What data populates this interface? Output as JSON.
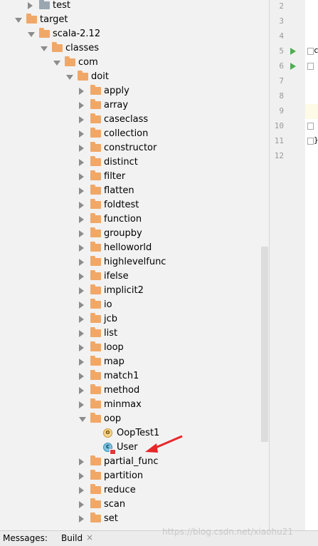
{
  "tree": {
    "rows": [
      {
        "label": "test",
        "depth": 1,
        "expanded": false,
        "type": "folder",
        "grey": true
      },
      {
        "label": "target",
        "depth": 0,
        "expanded": true,
        "type": "folder"
      },
      {
        "label": "scala-2.12",
        "depth": 1,
        "expanded": true,
        "type": "folder"
      },
      {
        "label": "classes",
        "depth": 2,
        "expanded": true,
        "type": "folder"
      },
      {
        "label": "com",
        "depth": 3,
        "expanded": true,
        "type": "folder"
      },
      {
        "label": "doit",
        "depth": 4,
        "expanded": true,
        "type": "folder"
      },
      {
        "label": "apply",
        "depth": 5,
        "expanded": false,
        "type": "folder"
      },
      {
        "label": "array",
        "depth": 5,
        "expanded": false,
        "type": "folder"
      },
      {
        "label": "caseclass",
        "depth": 5,
        "expanded": false,
        "type": "folder"
      },
      {
        "label": "collection",
        "depth": 5,
        "expanded": false,
        "type": "folder"
      },
      {
        "label": "constructor",
        "depth": 5,
        "expanded": false,
        "type": "folder"
      },
      {
        "label": "distinct",
        "depth": 5,
        "expanded": false,
        "type": "folder"
      },
      {
        "label": "filter",
        "depth": 5,
        "expanded": false,
        "type": "folder"
      },
      {
        "label": "flatten",
        "depth": 5,
        "expanded": false,
        "type": "folder"
      },
      {
        "label": "foldtest",
        "depth": 5,
        "expanded": false,
        "type": "folder"
      },
      {
        "label": "function",
        "depth": 5,
        "expanded": false,
        "type": "folder"
      },
      {
        "label": "groupby",
        "depth": 5,
        "expanded": false,
        "type": "folder"
      },
      {
        "label": "helloworld",
        "depth": 5,
        "expanded": false,
        "type": "folder"
      },
      {
        "label": "highlevelfunc",
        "depth": 5,
        "expanded": false,
        "type": "folder"
      },
      {
        "label": "ifelse",
        "depth": 5,
        "expanded": false,
        "type": "folder"
      },
      {
        "label": "implicit2",
        "depth": 5,
        "expanded": false,
        "type": "folder"
      },
      {
        "label": "io",
        "depth": 5,
        "expanded": false,
        "type": "folder"
      },
      {
        "label": "jcb",
        "depth": 5,
        "expanded": false,
        "type": "folder"
      },
      {
        "label": "list",
        "depth": 5,
        "expanded": false,
        "type": "folder"
      },
      {
        "label": "loop",
        "depth": 5,
        "expanded": false,
        "type": "folder"
      },
      {
        "label": "map",
        "depth": 5,
        "expanded": false,
        "type": "folder"
      },
      {
        "label": "match1",
        "depth": 5,
        "expanded": false,
        "type": "folder"
      },
      {
        "label": "method",
        "depth": 5,
        "expanded": false,
        "type": "folder"
      },
      {
        "label": "minmax",
        "depth": 5,
        "expanded": false,
        "type": "folder"
      },
      {
        "label": "oop",
        "depth": 5,
        "expanded": true,
        "type": "folder"
      },
      {
        "label": "OopTest1",
        "depth": 6,
        "type": "object"
      },
      {
        "label": "User",
        "depth": 6,
        "type": "class"
      },
      {
        "label": "partial_func",
        "depth": 5,
        "expanded": false,
        "type": "folder"
      },
      {
        "label": "partition",
        "depth": 5,
        "expanded": false,
        "type": "folder"
      },
      {
        "label": "reduce",
        "depth": 5,
        "expanded": false,
        "type": "folder"
      },
      {
        "label": "scan",
        "depth": 5,
        "expanded": false,
        "type": "folder"
      },
      {
        "label": "set",
        "depth": 5,
        "expanded": false,
        "type": "folder"
      }
    ]
  },
  "editor": {
    "line_numbers": [
      "2",
      "3",
      "4",
      "5",
      "6",
      "7",
      "8",
      "9",
      "10",
      "11",
      "12"
    ],
    "run_lines": [
      "5",
      "6"
    ],
    "fold_lines": [
      "5",
      "6",
      "10",
      "11"
    ],
    "code_fragments": {
      "5": "c",
      "11": "}"
    }
  },
  "statusbar": {
    "messages_label": "Messages:",
    "build_label": "Build",
    "close_glyph": "×"
  },
  "watermark": "https://blog.csdn.net/xiaohu21",
  "colors": {
    "folder": "#f0a868",
    "folder_grey": "#9aa7b0",
    "annotation_arrow": "#e8262a",
    "run_icon": "#4caf50"
  }
}
